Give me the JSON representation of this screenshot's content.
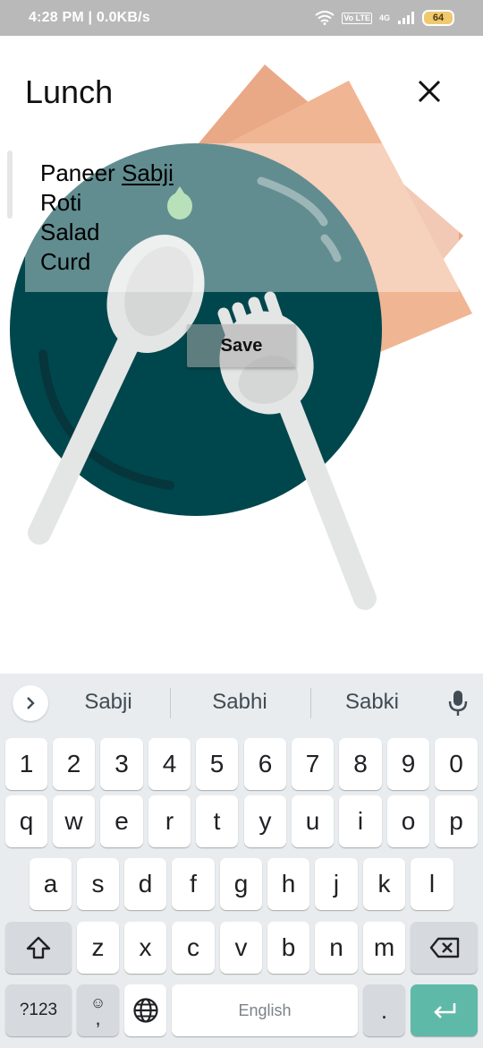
{
  "status_bar": {
    "time_speed": "4:28 PM | 0.0KB/s",
    "volte": "Vo LTE",
    "network_gen": "4G",
    "battery": "64"
  },
  "header": {
    "title": "Lunch"
  },
  "menu_items": [
    "Paneer ",
    "Sabji",
    "Roti",
    "Salad",
    "Curd"
  ],
  "save_label": "Save",
  "keyboard": {
    "suggestions": [
      "Sabji",
      "Sabhi",
      "Sabki"
    ],
    "number_row": [
      "1",
      "2",
      "3",
      "4",
      "5",
      "6",
      "7",
      "8",
      "9",
      "0"
    ],
    "row1": [
      "q",
      "w",
      "e",
      "r",
      "t",
      "y",
      "u",
      "i",
      "o",
      "p"
    ],
    "row2": [
      "a",
      "s",
      "d",
      "f",
      "g",
      "h",
      "j",
      "k",
      "l"
    ],
    "row3": [
      "z",
      "x",
      "c",
      "v",
      "b",
      "n",
      "m"
    ],
    "symbols_label": "?123",
    "emoji_label": "☺",
    "comma_label": ",",
    "space_label": "English",
    "period_label": "."
  },
  "colors": {
    "plate": "#00474d",
    "napkin": "#f0b592",
    "cutlery": "#e4e5e5",
    "enter_key": "#5fb9a8"
  }
}
